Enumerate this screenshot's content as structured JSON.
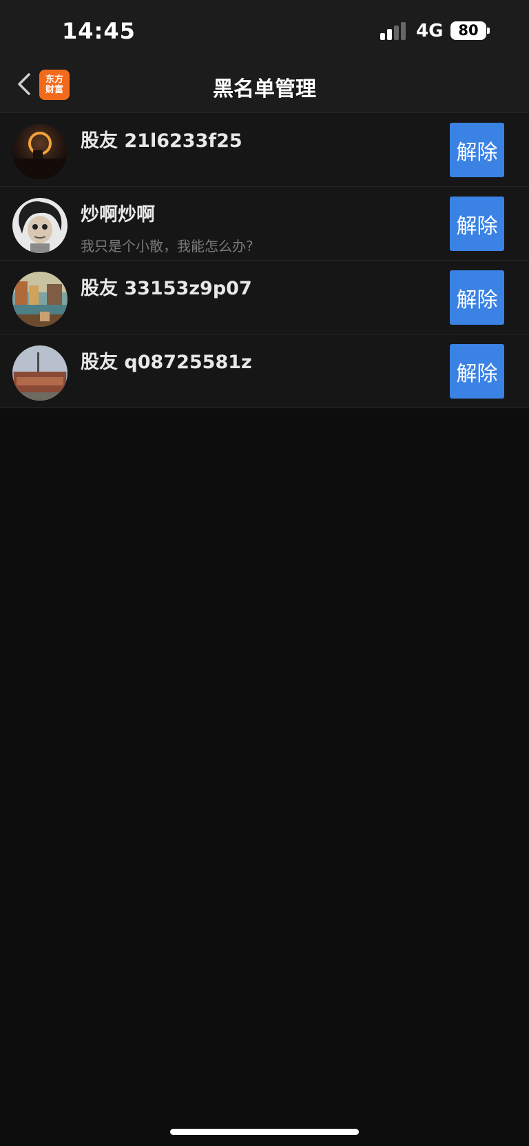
{
  "status_bar": {
    "time": "14:45",
    "network": "4G",
    "battery": "80"
  },
  "nav": {
    "back_icon": "chevron-left-icon",
    "logo_line1": "东方",
    "logo_line2": "财富",
    "title": "黑名单管理"
  },
  "blocked_users": [
    {
      "name": "股友 21l6233f25",
      "bio": "",
      "button": "解除",
      "avatar": "eclipse-avatar"
    },
    {
      "name": "炒啊炒啊",
      "bio": "我只是个小散，我能怎么办?",
      "button": "解除",
      "avatar": "cartoon-girl-avatar"
    },
    {
      "name": "股友 33153z9p07",
      "bio": "",
      "button": "解除",
      "avatar": "painting-avatar"
    },
    {
      "name": "股友 q08725581z",
      "bio": "",
      "button": "解除",
      "avatar": "sign-avatar"
    }
  ],
  "colors": {
    "accent_button": "#3a82e4",
    "logo_orange": "#f26a1b",
    "background": "#0d0d0d"
  }
}
